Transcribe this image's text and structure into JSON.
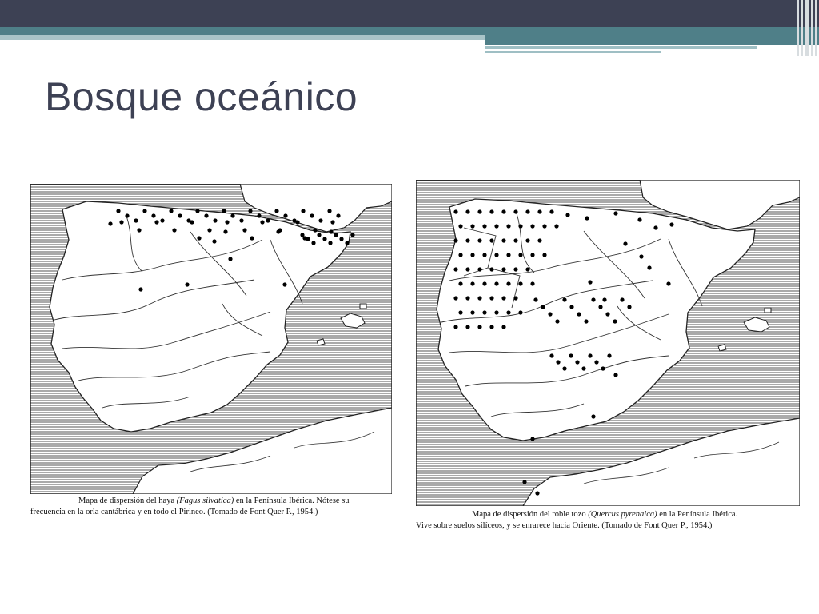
{
  "slide": {
    "title": "Bosque oceánico"
  },
  "figures": [
    {
      "caption_line1_a": "Mapa de dispersión del haya ",
      "caption_line1_species": "(Fagus silvatica)",
      "caption_line1_b": " en la Península Ibérica. Nótese su",
      "caption_line2": "frecuencia en la orla cantábrica y en todo el Pirineo. (Tomado de Font Quer P., 1954.)"
    },
    {
      "caption_line1_a": "Mapa de dispersión del roble tozo ",
      "caption_line1_species": "(Quercus pyrenaica)",
      "caption_line1_b": " en la Península Ibérica.",
      "caption_line2": "Vive sobre suelos silíceos, y se enrarece hacia Oriente. (Tomado de Font Quer P., 1954.)"
    }
  ],
  "colors": {
    "header_dark": "#3d4154",
    "header_teal": "#4f7f88",
    "title": "#3d4154",
    "sea_hatch": "#555555",
    "dots": "#000000"
  }
}
